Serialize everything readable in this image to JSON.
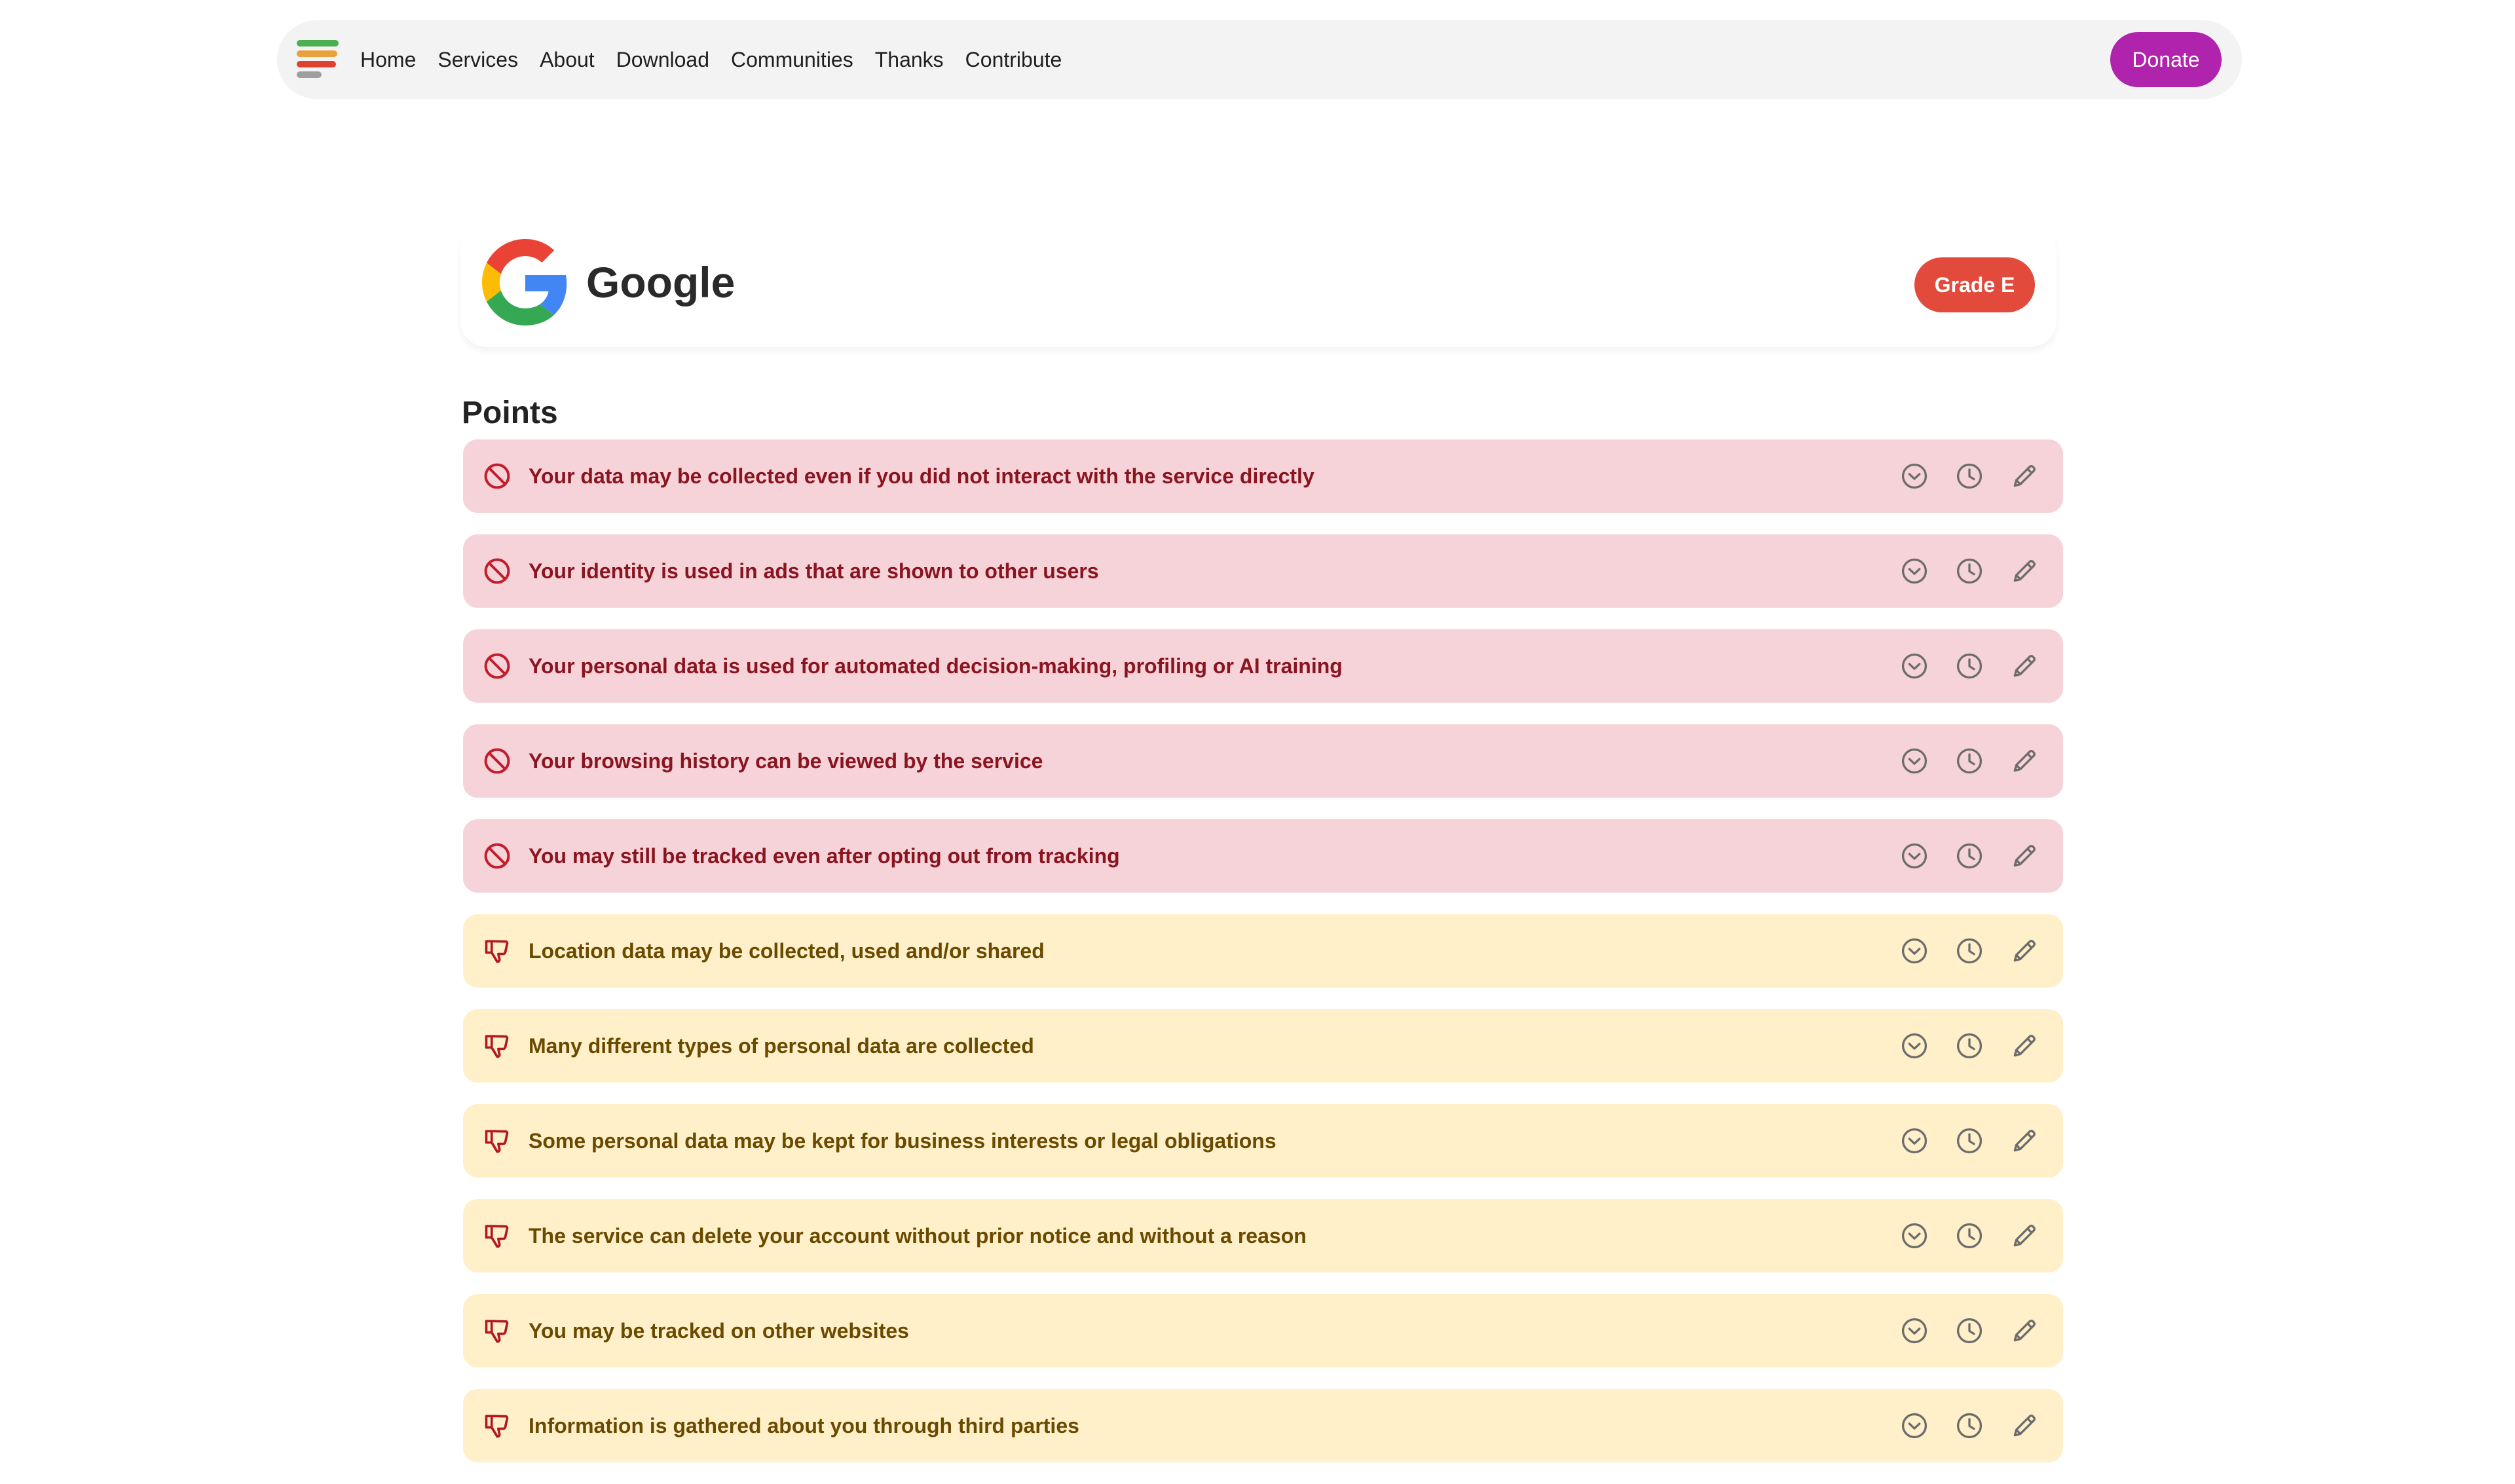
{
  "colors": {
    "nav_bg": "#f3f3f3",
    "donate": "#b024ad",
    "grade": "#e24a3c",
    "blocker_bg": "#f6d3d8",
    "blocker_text": "#8a1420",
    "blocker_icon": "#c21d2d",
    "bad_bg": "#fff0c9",
    "bad_text": "#6a4a00",
    "bad_icon": "#b3181f",
    "action_icon": "#6c6c6c",
    "logo_bars": [
      "#4caf50",
      "#e9a13b",
      "#e0412f",
      "#9e9e9e"
    ]
  },
  "nav": {
    "logo_icon": "tosdr-logo-icon",
    "links": [
      "Home",
      "Services",
      "About",
      "Download",
      "Communities",
      "Thanks",
      "Contribute"
    ],
    "donate_label": "Donate"
  },
  "service": {
    "name": "Google",
    "logo_icon": "google-g-icon",
    "grade_label": "Grade E"
  },
  "points_heading": "Points",
  "points": [
    {
      "type": "blocker",
      "icon": "prohibited-icon",
      "text": "Your data may be collected even if you did not interact with the service directly"
    },
    {
      "type": "blocker",
      "icon": "prohibited-icon",
      "text": "Your identity is used in ads that are shown to other users"
    },
    {
      "type": "blocker",
      "icon": "prohibited-icon",
      "text": "Your personal data is used for automated decision-making, profiling or AI training"
    },
    {
      "type": "blocker",
      "icon": "prohibited-icon",
      "text": "Your browsing history can be viewed by the service"
    },
    {
      "type": "blocker",
      "icon": "prohibited-icon",
      "text": "You may still be tracked even after opting out from tracking"
    },
    {
      "type": "bad",
      "icon": "thumbs-down-icon",
      "text": "Location data may be collected, used and/or shared"
    },
    {
      "type": "bad",
      "icon": "thumbs-down-icon",
      "text": "Many different types of personal data are collected"
    },
    {
      "type": "bad",
      "icon": "thumbs-down-icon",
      "text": "Some personal data may be kept for business interests or legal obligations"
    },
    {
      "type": "bad",
      "icon": "thumbs-down-icon",
      "text": "The service can delete your account without prior notice and without a reason"
    },
    {
      "type": "bad",
      "icon": "thumbs-down-icon",
      "text": "You may be tracked on other websites"
    },
    {
      "type": "bad",
      "icon": "thumbs-down-icon",
      "text": "Information is gathered about you through third parties"
    }
  ],
  "point_action_icons": [
    "expand-chevron-icon",
    "history-clock-icon",
    "edit-pencil-icon"
  ]
}
